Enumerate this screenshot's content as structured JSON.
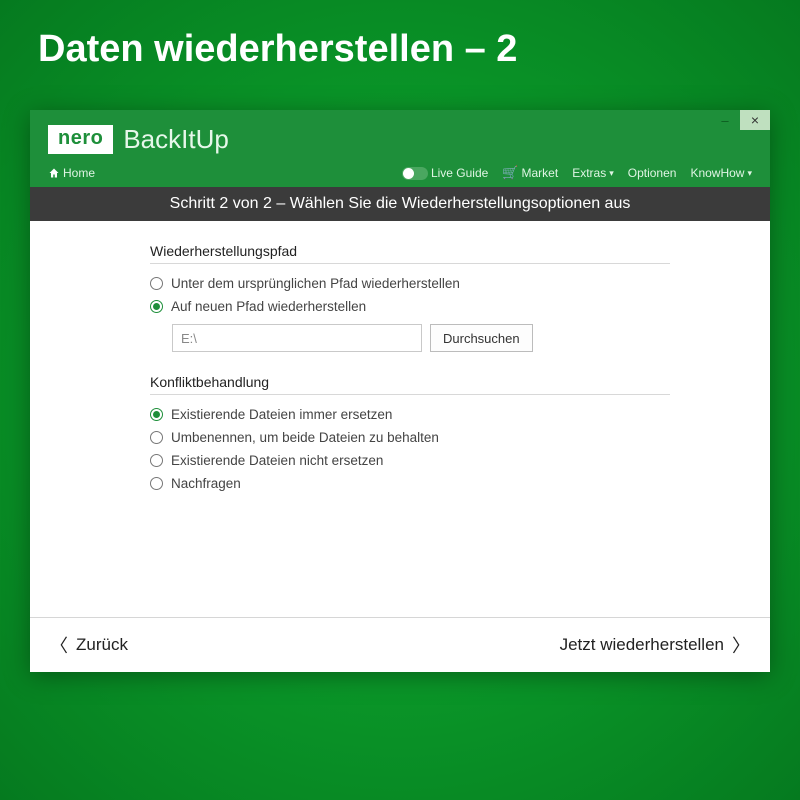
{
  "page_heading": "Daten wiederherstellen – 2",
  "brand": {
    "badge": "nero",
    "product": "BackItUp"
  },
  "menubar": {
    "home": "Home",
    "live_guide": "Live Guide",
    "market": "Market",
    "extras": "Extras",
    "optionen": "Optionen",
    "knowhow": "KnowHow"
  },
  "step_bar": "Schritt 2 von 2 – Wählen Sie die Wiederherstellungsoptionen aus",
  "section_path": {
    "title": "Wiederherstellungspfad",
    "opt_original": "Unter dem ursprünglichen Pfad wiederherstellen",
    "opt_new": "Auf neuen Pfad wiederherstellen",
    "path_value": "E:\\",
    "browse": "Durchsuchen",
    "selected": "new"
  },
  "section_conflict": {
    "title": "Konfliktbehandlung",
    "opt_replace": "Existierende Dateien immer ersetzen",
    "opt_rename": "Umbenennen, um beide Dateien zu behalten",
    "opt_skip": "Existierende Dateien nicht ersetzen",
    "opt_ask": "Nachfragen",
    "selected": "replace"
  },
  "footer": {
    "back": "Zurück",
    "next": "Jetzt wiederherstellen"
  }
}
